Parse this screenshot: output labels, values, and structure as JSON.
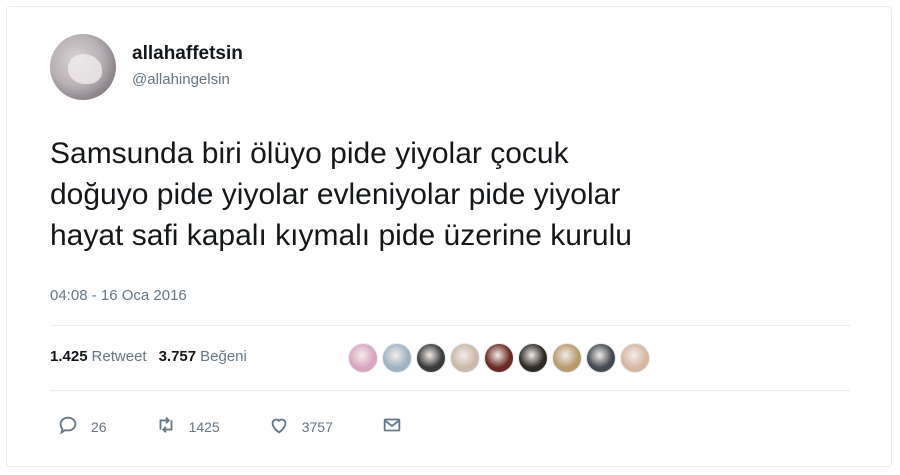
{
  "user": {
    "display_name": "allahaffetsin",
    "handle": "@allahingelsin",
    "avatar_icon": "avatar-photo"
  },
  "tweet": {
    "lines": [
      "Samsunda biri ölüyo pide yiyolar çocuk",
      "doğuyo pide yiyolar evleniyolar pide yiyolar",
      "hayat safi kapalı kıymalı pide üzerine kurulu"
    ],
    "timestamp": "04:08 - 16 Oca 2016"
  },
  "stats": {
    "retweets_count": "1.425",
    "retweets_label": "Retweet",
    "likes_count": "3.757",
    "likes_label": "Beğeni"
  },
  "likers": {
    "colors": [
      "#d9a6c4",
      "#9fb3c4",
      "#3a3a3a",
      "#c9b9a8",
      "#6b2b22",
      "#2f2a26",
      "#b89a6e",
      "#444a52",
      "#d7b7a2"
    ]
  },
  "actions": {
    "reply": {
      "icon": "reply-icon",
      "count": "26"
    },
    "retweet": {
      "icon": "retweet-icon",
      "count": "1425"
    },
    "like": {
      "icon": "heart-icon",
      "count": "3757"
    },
    "dm": {
      "icon": "envelope-icon"
    }
  },
  "colors": {
    "text": "#14171a",
    "muted": "#657786",
    "border": "#e6ecf0"
  }
}
